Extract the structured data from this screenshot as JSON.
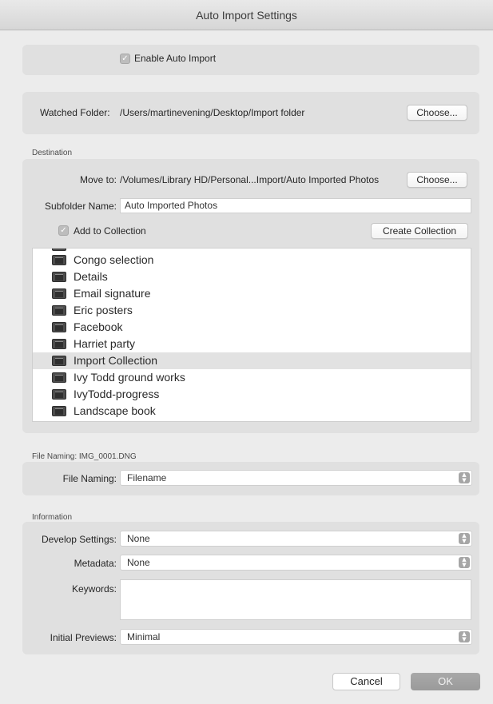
{
  "window": {
    "title": "Auto Import Settings"
  },
  "enable": {
    "label": "Enable Auto Import",
    "checked": true
  },
  "watched": {
    "label": "Watched Folder:",
    "path": "/Users/martinevening/Desktop/Import folder",
    "choose_label": "Choose..."
  },
  "destination": {
    "section_label": "Destination",
    "move_to_label": "Move to:",
    "move_to_path": "/Volumes/Library HD/Personal...Import/Auto Imported Photos",
    "choose_label": "Choose...",
    "subfolder_label": "Subfolder Name:",
    "subfolder_value": "Auto Imported Photos",
    "add_to_collection_label": "Add to Collection",
    "add_to_collection_checked": true,
    "create_collection_label": "Create Collection",
    "collections": [
      {
        "name": "Congo selection",
        "selected": false
      },
      {
        "name": "Details",
        "selected": false
      },
      {
        "name": "Email signature",
        "selected": false
      },
      {
        "name": "Eric posters",
        "selected": false
      },
      {
        "name": "Facebook",
        "selected": false
      },
      {
        "name": "Harriet party",
        "selected": false
      },
      {
        "name": "Import Collection",
        "selected": true
      },
      {
        "name": "Ivy Todd ground works",
        "selected": false
      },
      {
        "name": "IvyTodd-progress",
        "selected": false
      },
      {
        "name": "Landscape book",
        "selected": false
      }
    ]
  },
  "file_naming": {
    "section_label": "File Naming: IMG_0001.DNG",
    "label": "File Naming:",
    "value": "Filename"
  },
  "information": {
    "section_label": "Information",
    "develop_label": "Develop Settings:",
    "develop_value": "None",
    "metadata_label": "Metadata:",
    "metadata_value": "None",
    "keywords_label": "Keywords:",
    "keywords_value": "",
    "previews_label": "Initial Previews:",
    "previews_value": "Minimal"
  },
  "footer": {
    "cancel_label": "Cancel",
    "ok_label": "OK"
  },
  "icons": {
    "checkbox_check": "checkmark-icon",
    "select_arrow": "updown-chevron-icon",
    "collection": "collection-icon"
  }
}
